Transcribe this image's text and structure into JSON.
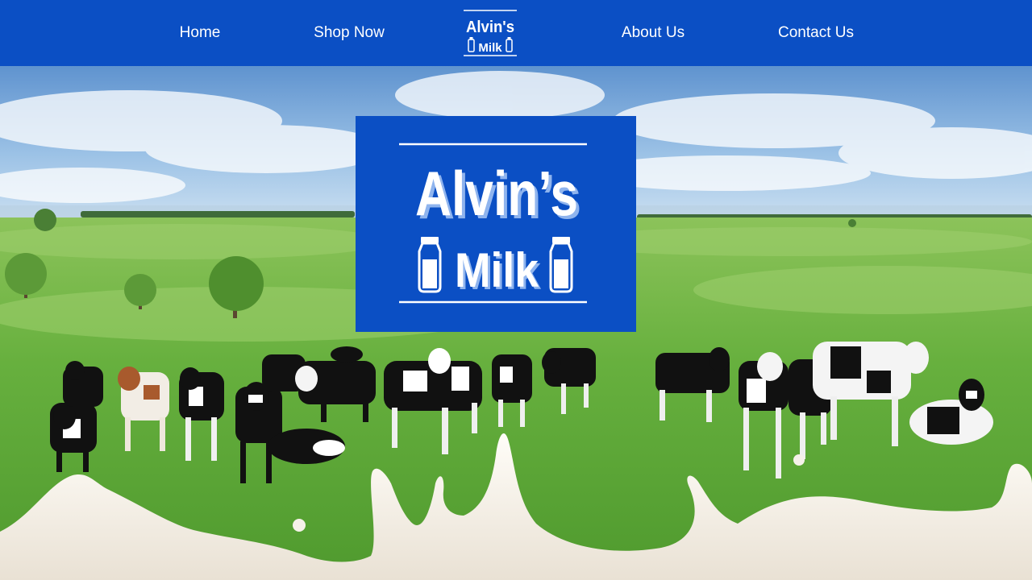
{
  "nav": {
    "home_label": "Home",
    "shop_label": "Shop Now",
    "about_label": "About Us",
    "contact_label": "Contact Us",
    "logo_line1": "Alvin's",
    "logo_line2": "Milk"
  },
  "hero": {
    "logo_line1": "Alvin’s",
    "logo_line2": "Milk"
  },
  "colors": {
    "brand_blue": "#0b4fc4",
    "nav_text": "#ffffff",
    "grass": "#5fae3c",
    "sky": "#7fb4e0",
    "milk": "#f6f1ea"
  },
  "icons": [
    "milk-bottle-icon"
  ]
}
